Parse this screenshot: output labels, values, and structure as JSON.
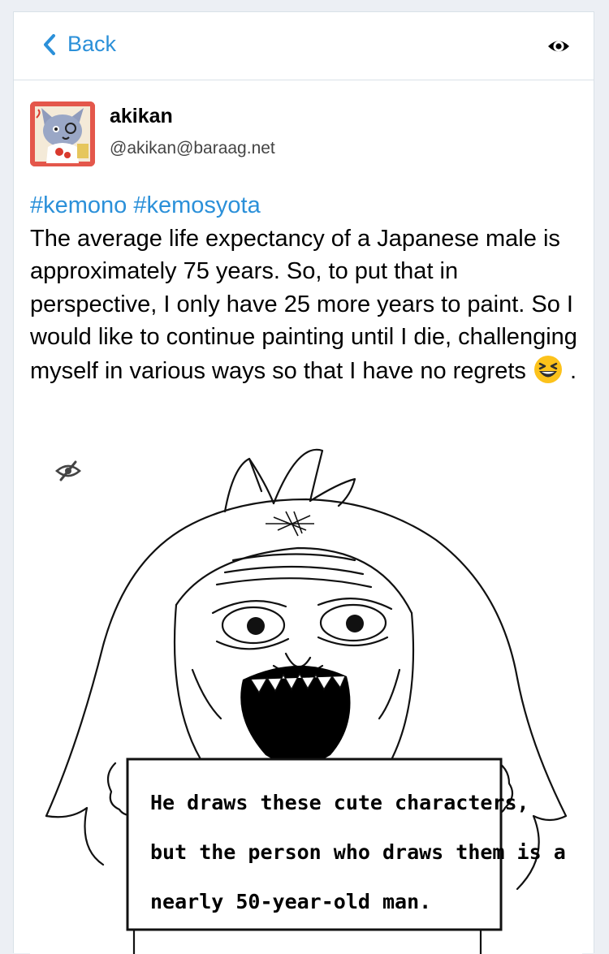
{
  "topbar": {
    "back_label": "Back",
    "visibility_icon": "eye-icon"
  },
  "account": {
    "display_name": "akikan",
    "handle": "@akikan@baraag.net",
    "avatar_colors": {
      "bg": "#e4574b",
      "fur": "#9aa7c6"
    }
  },
  "status": {
    "hashtags": [
      "#kemono",
      "#kemosyota"
    ],
    "text": "The average life expectancy of a Japanese male is approximately 75 years. So, to put that in perspective, I only have 25 more years to paint. So I would like to continue painting until I die, challenging myself in various ways so that I have no regrets",
    "trailing": " .",
    "emoji": "laughing-face-emoji"
  },
  "media": {
    "hide_icon": "eye-slash-icon",
    "sign_lines": [
      "He draws these cute characters,",
      "but the person who draws them is a",
      "nearly 50-year-old man."
    ]
  },
  "colors": {
    "accent": "#2b90d9",
    "border": "#d9e1e8",
    "background": "#eceff4"
  }
}
